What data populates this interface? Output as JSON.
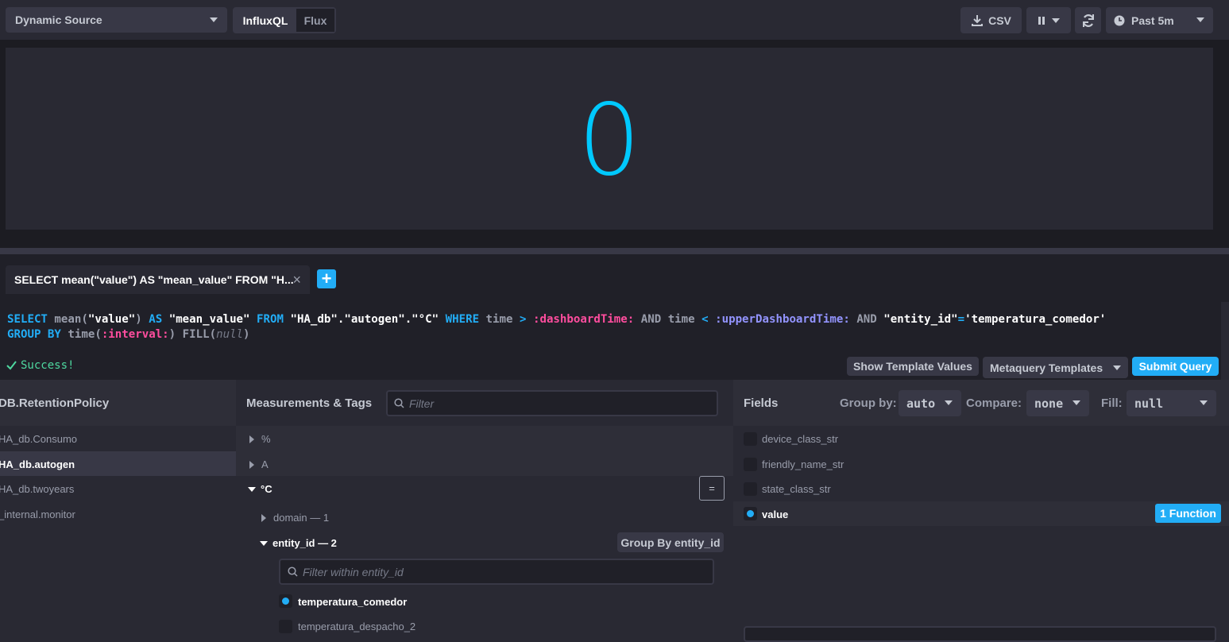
{
  "toolbar": {
    "source_label": "Dynamic Source",
    "lang_tabs": [
      "InfluxQL",
      "Flux"
    ],
    "csv_label": "CSV",
    "time_range_label": "Past 5m"
  },
  "graph": {
    "single_stat_value": "0",
    "value_color": "#00c9ff"
  },
  "query_tab": {
    "label": "SELECT mean(\"value\") AS \"mean_value\" FROM \"H...",
    "close_symbol": "×",
    "add_symbol": "+"
  },
  "editor": {
    "line1": [
      {
        "t": "SELECT ",
        "c": "kw"
      },
      {
        "t": "mean(",
        "c": "fn"
      },
      {
        "t": "\"value\"",
        "c": "str"
      },
      {
        "t": ") ",
        "c": "fn"
      },
      {
        "t": "AS ",
        "c": "kw"
      },
      {
        "t": "\"mean_value\" ",
        "c": "str"
      },
      {
        "t": "FROM ",
        "c": "kw"
      },
      {
        "t": "\"HA_db\".\"autogen\".\"°C\" ",
        "c": "str"
      },
      {
        "t": "WHERE ",
        "c": "kw"
      },
      {
        "t": "time ",
        "c": "fn"
      },
      {
        "t": "> ",
        "c": "kw"
      },
      {
        "t": ":dashboardTime: ",
        "c": "tv1"
      },
      {
        "t": "AND ",
        "c": "fn"
      },
      {
        "t": "time ",
        "c": "fn"
      },
      {
        "t": "< ",
        "c": "kw"
      },
      {
        "t": ":upperDashboardTime: ",
        "c": "tv2"
      },
      {
        "t": "AND ",
        "c": "fn"
      },
      {
        "t": "\"entity_id\"",
        "c": "str"
      },
      {
        "t": "=",
        "c": "kw"
      },
      {
        "t": "'temperatura_comedor'",
        "c": "str"
      }
    ],
    "line2": [
      {
        "t": "GROUP BY ",
        "c": "kw"
      },
      {
        "t": "time(",
        "c": "fn"
      },
      {
        "t": ":interval:",
        "c": "tv1"
      },
      {
        "t": ") ",
        "c": "fn"
      },
      {
        "t": "FILL(",
        "c": "fn"
      },
      {
        "t": "null",
        "c": "nul"
      },
      {
        "t": ")",
        "c": "fn"
      }
    ],
    "status": "Success!",
    "show_template_values": "Show Template Values",
    "metaquery_templates": "Metaquery Templates",
    "submit_query": "Submit Query"
  },
  "db_panel": {
    "title": "DB.RetentionPolicy",
    "items": [
      "HA_db.Consumo",
      "HA_db.autogen",
      "HA_db.twoyears",
      "_internal.monitor"
    ],
    "selected_index": 1
  },
  "measurements_panel": {
    "title": "Measurements & Tags",
    "filter_placeholder": "Filter",
    "items": [
      "%",
      "A",
      "°C"
    ],
    "equals_symbol": "=",
    "tag_keys": [
      {
        "label": "domain — 1"
      },
      {
        "label": "entity_id — 2",
        "group_by_label": "Group By entity_id"
      }
    ],
    "tag_filter_placeholder": "Filter within entity_id",
    "tag_values": [
      "temperatura_comedor",
      "temperatura_despacho_2"
    ]
  },
  "fields_panel": {
    "title": "Fields",
    "group_by_label": "Group by:",
    "group_by_value": "auto",
    "compare_label": "Compare:",
    "compare_value": "none",
    "fill_label": "Fill:",
    "fill_value": "null",
    "fields": [
      "device_class_str",
      "friendly_name_str",
      "state_class_str",
      "value"
    ],
    "function_badge": "1 Function"
  },
  "colors": {
    "accent": "#22adf6",
    "keyword": "#22adf6",
    "template_var_1": "#ff4d9e",
    "template_var_2": "#9394ff",
    "success": "#4ed8a0"
  }
}
